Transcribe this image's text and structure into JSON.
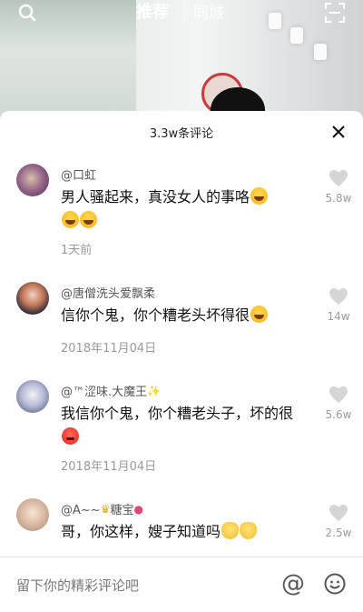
{
  "top_nav": {
    "tab_recommend": "推荐",
    "tab_city": "同城"
  },
  "sheet": {
    "title": "3.3w条评论"
  },
  "comments": [
    {
      "username": "@口虹",
      "text": "男人骚起来，真没女人的事咯",
      "emoji_tail": [
        "laughing-crying",
        "laughing-crying",
        "laughing-crying"
      ],
      "date": "1天前",
      "likes": "5.8w"
    },
    {
      "username": "@唐僧洗头爱飘柔",
      "text": "信你个鬼，你个糟老头坏得很",
      "emoji_tail": [
        "laughing-crying"
      ],
      "date": "2018年11月04日",
      "likes": "14w"
    },
    {
      "username": "@™涩味.大魔王",
      "text": "我信你个鬼，你个糟老头子，坏的很",
      "emoji_tail": [
        "angry"
      ],
      "date": "2018年11月04日",
      "likes": "5.6w"
    },
    {
      "username": "@A~~",
      "username_suffix": "糖宝",
      "text": "哥，你这样，嫂子知道吗",
      "emoji_tail": [
        "clap",
        "clap"
      ],
      "likes": "2.5w"
    }
  ],
  "input_bar": {
    "placeholder": "留下你的精彩评论吧"
  },
  "colors": {
    "sheet_bg": "#ffffff",
    "text_primary": "#111111",
    "text_secondary": "#999999",
    "like_icon": "#d6d6d6"
  }
}
